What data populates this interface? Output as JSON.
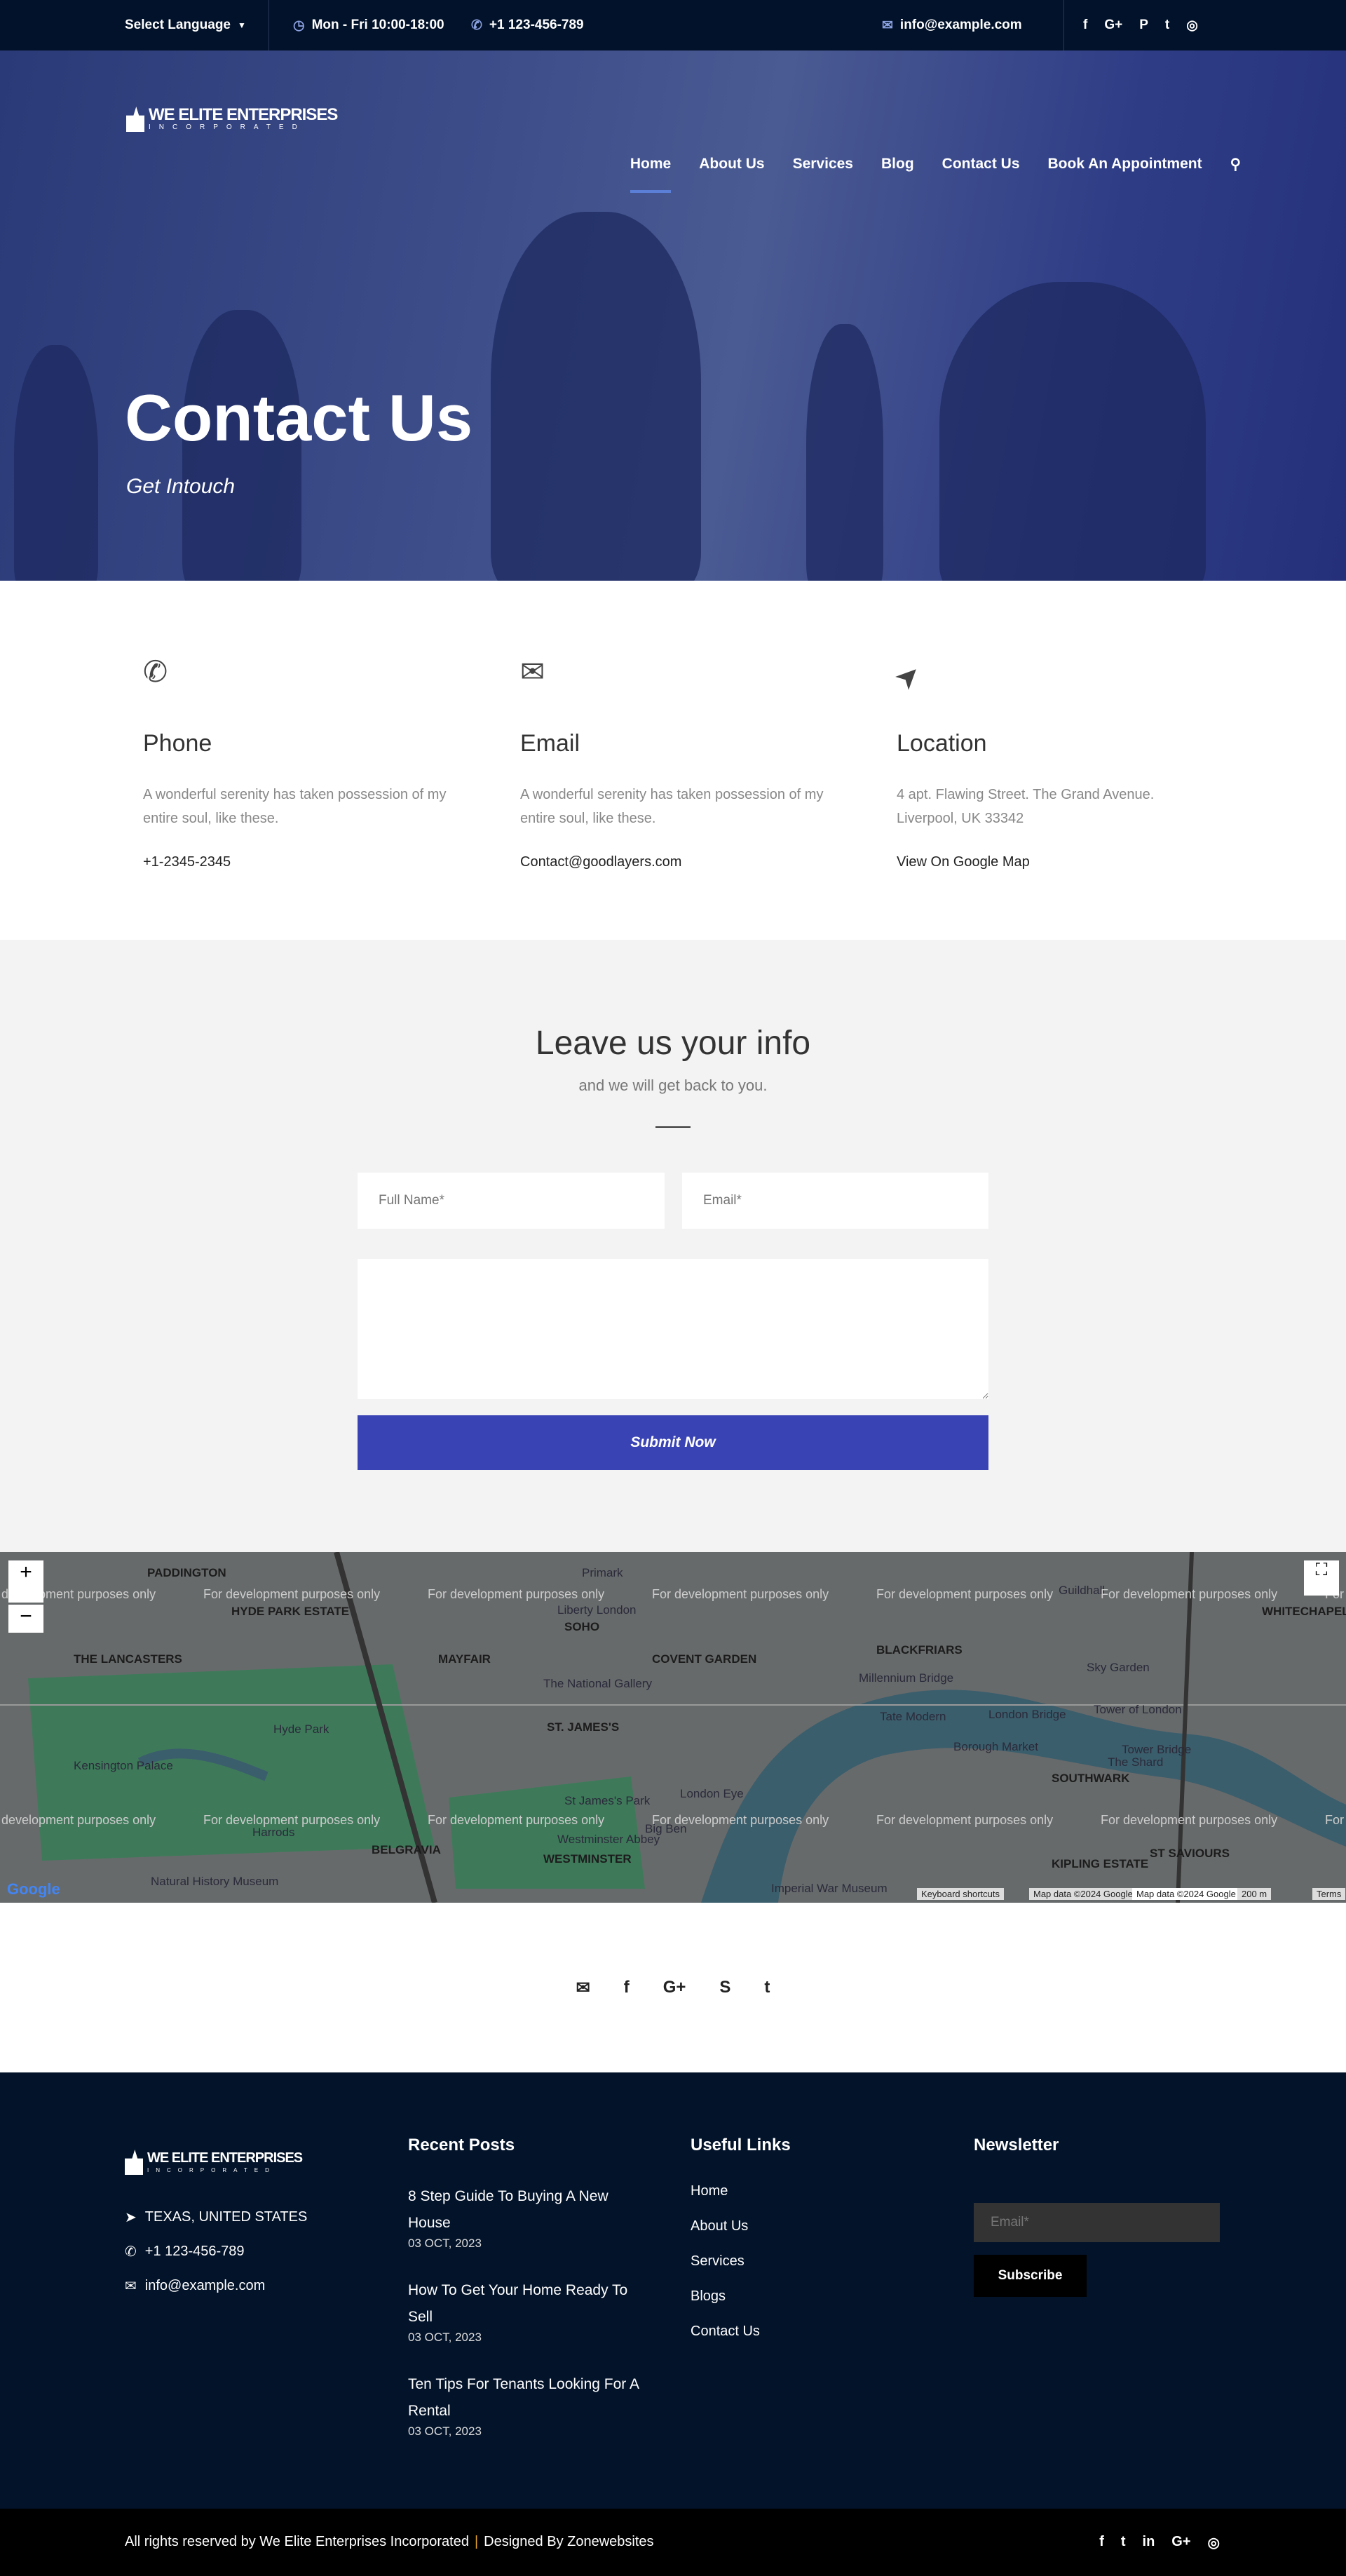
{
  "topbar": {
    "language": "Select Language",
    "hours": "Mon - Fri 10:00-18:00",
    "phone": "+1 123-456-789",
    "email": "info@example.com",
    "social": [
      "f",
      "G+",
      "P",
      "t",
      "◎"
    ]
  },
  "brand": {
    "name": "WE ELITE ENTERPRISES",
    "tagline": "INCORPORATED"
  },
  "nav": {
    "items": [
      "Home",
      "About Us",
      "Services",
      "Blog",
      "Contact Us",
      "Book An Appointment"
    ],
    "active": "Home",
    "search_icon": "⚲"
  },
  "hero": {
    "title": "Contact Us",
    "subtitle": "Get Intouch"
  },
  "info": [
    {
      "icon": "✆",
      "title": "Phone",
      "text": "A wonderful serenity has taken possession of my entire soul, like these.",
      "link": "+1-2345-2345"
    },
    {
      "icon": "✉",
      "title": "Email",
      "text": "A wonderful serenity has taken possession of my entire soul, like these.",
      "link": "Contact@goodlayers.com"
    },
    {
      "icon": "➤",
      "title": "Location",
      "text": "4 apt. Flawing Street. The Grand Avenue. Liverpool, UK 33342",
      "link": "View On Google Map"
    }
  ],
  "form": {
    "title": "Leave us your info",
    "subtitle": "and we will get back to you.",
    "name_placeholder": "Full Name*",
    "email_placeholder": "Email*",
    "submit": "Submit Now",
    "accent": "#3a43b4"
  },
  "map": {
    "watermark": "For development purposes only",
    "labels": [
      "PADDINGTON",
      "HYDE PARK ESTATE",
      "THE LANCASTERS",
      "MAYFAIR",
      "SOHO",
      "COVENT GARDEN",
      "BLACKFRIARS",
      "ST. JAMES'S",
      "BELGRAVIA",
      "WESTMINSTER",
      "KIPLING ESTATE",
      "ST SAVIOURS",
      "WHITECHAPEL",
      "SOUTHWARK",
      "Hyde Park",
      "Kensington Palace",
      "The National Gallery",
      "Tate Modern",
      "London Bridge",
      "Tower of London",
      "Tower Bridge",
      "The Shard",
      "Borough Market",
      "Sky Garden",
      "Millennium Bridge",
      "Westminster Abbey",
      "Harrods",
      "Natural History Museum",
      "Imperial War Museum",
      "Liberty London",
      "Primark",
      "Guildhall",
      "London Eye",
      "Big Ben",
      "St James's Park"
    ],
    "attribution": [
      "Keyboard shortcuts",
      "Map data ©2024 Google",
      "Map data ©2024 Google",
      "200 m",
      "Terms"
    ],
    "logo": "Google"
  },
  "social_row": [
    "✉",
    "f",
    "G+",
    "S",
    "t"
  ],
  "footer": {
    "location": "TEXAS, UNITED STATES",
    "phone": "+1 123-456-789",
    "email": "info@example.com",
    "recent_title": "Recent Posts",
    "posts": [
      {
        "title": "8 Step Guide To Buying A New House",
        "date": "03 OCT, 2023"
      },
      {
        "title": "How To Get Your Home Ready To Sell",
        "date": "03 OCT, 2023"
      },
      {
        "title": "Ten Tips For Tenants Looking For A Rental",
        "date": "03 OCT, 2023"
      }
    ],
    "links_title": "Useful Links",
    "links": [
      "Home",
      "About Us",
      "Services",
      "Blogs",
      "Contact Us"
    ],
    "newsletter_title": "Newsletter",
    "newsletter_placeholder": "Email*",
    "subscribe": "Subscribe"
  },
  "bottom": {
    "copyright": "All rights reserved by We Elite Enterprises Incorporated",
    "separator": "|",
    "designed": "Designed By Zonewebsites",
    "social": [
      "f",
      "t",
      "in",
      "G+",
      "◎"
    ]
  }
}
